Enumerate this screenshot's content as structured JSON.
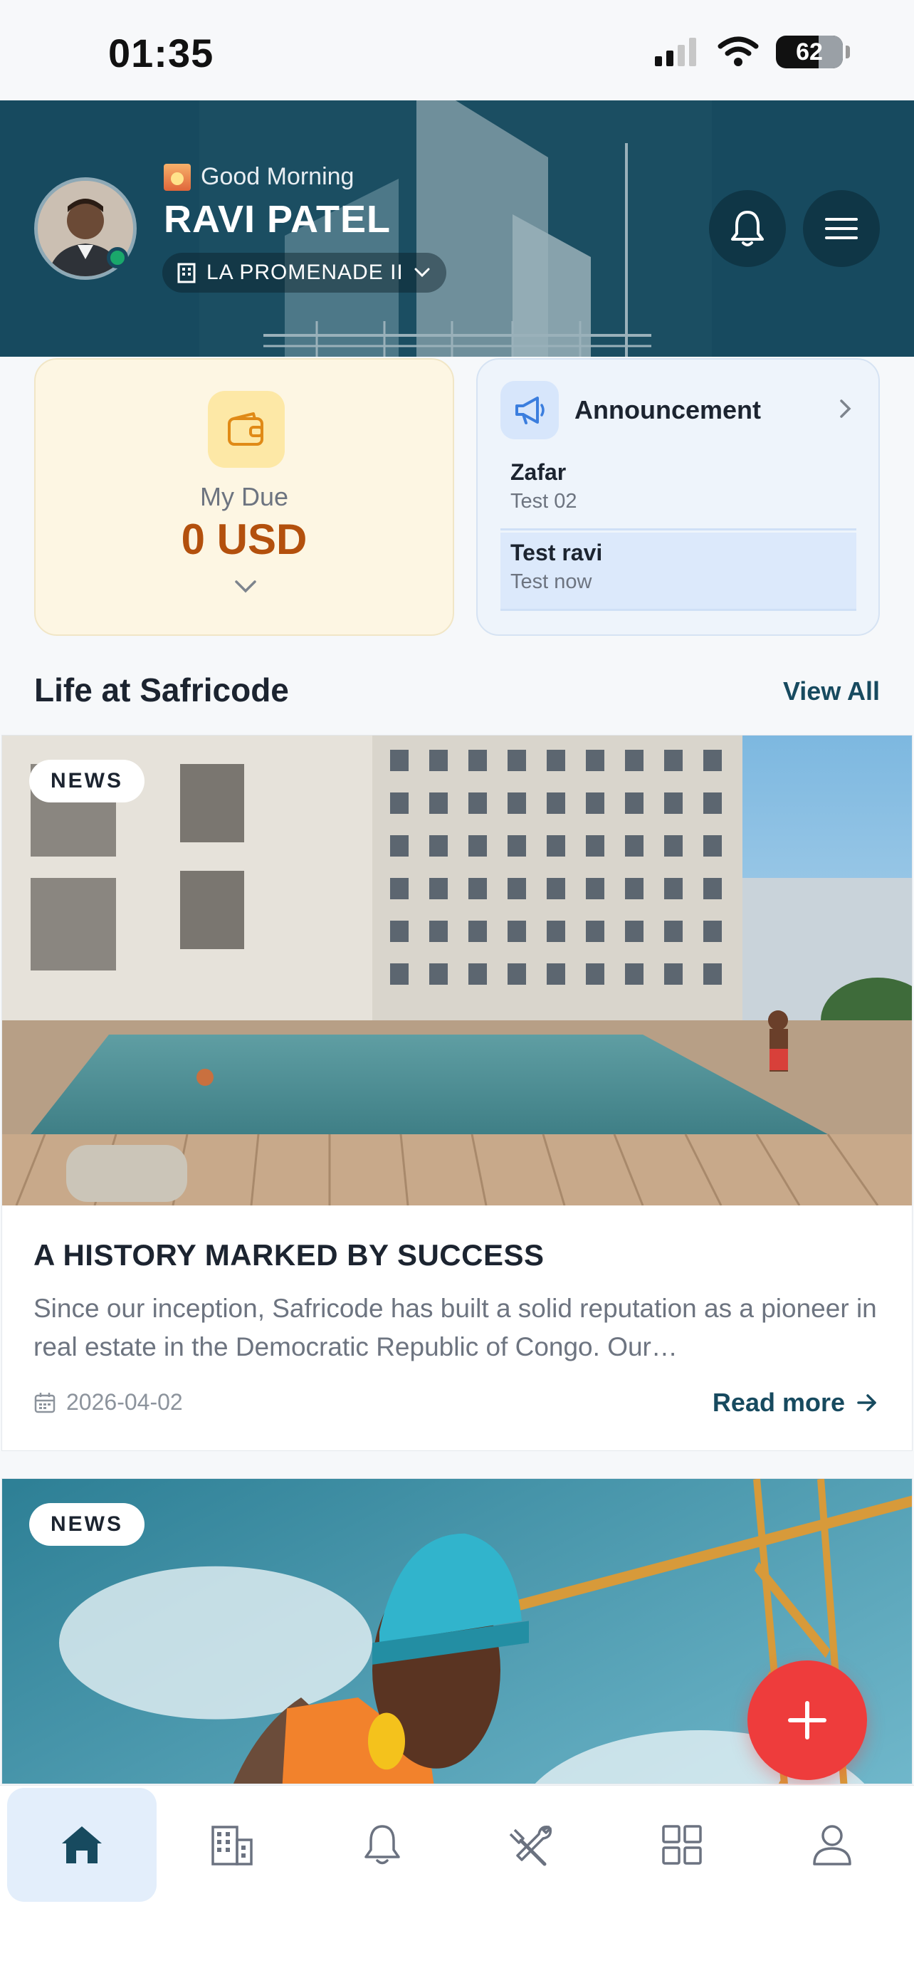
{
  "status_bar": {
    "time": "01:35",
    "battery": "62"
  },
  "header": {
    "greeting": "Good Morning",
    "user_name": "RAVI PATEL",
    "property": "LA PROMENADE II"
  },
  "due_card": {
    "label": "My Due",
    "value": "0 USD"
  },
  "announcement": {
    "title": "Announcement",
    "items": [
      {
        "name": "Zafar",
        "subtitle": "Test 02"
      },
      {
        "name": "Test ravi",
        "subtitle": "Test now"
      }
    ]
  },
  "life_section": {
    "title": "Life at Safricode",
    "view_all": "View All"
  },
  "news": [
    {
      "badge": "NEWS",
      "title": "A HISTORY MARKED BY SUCCESS",
      "excerpt": "Since our inception, Safricode has built a solid reputation as a pioneer in real estate in the Democratic Republic of Congo. Our…",
      "date": "2026-04-02",
      "read_more": "Read more"
    },
    {
      "badge": "NEWS"
    }
  ],
  "tabs": [
    {
      "icon": "home-icon",
      "active": true
    },
    {
      "icon": "building-icon",
      "active": false
    },
    {
      "icon": "bell-icon",
      "active": false
    },
    {
      "icon": "tools-icon",
      "active": false
    },
    {
      "icon": "grid-icon",
      "active": false
    },
    {
      "icon": "user-icon",
      "active": false
    }
  ],
  "colors": {
    "primary": "#174a5f",
    "due_accent": "#b3500d",
    "fab": "#ee3c3c",
    "active_tab_bg": "#e3eefb"
  }
}
